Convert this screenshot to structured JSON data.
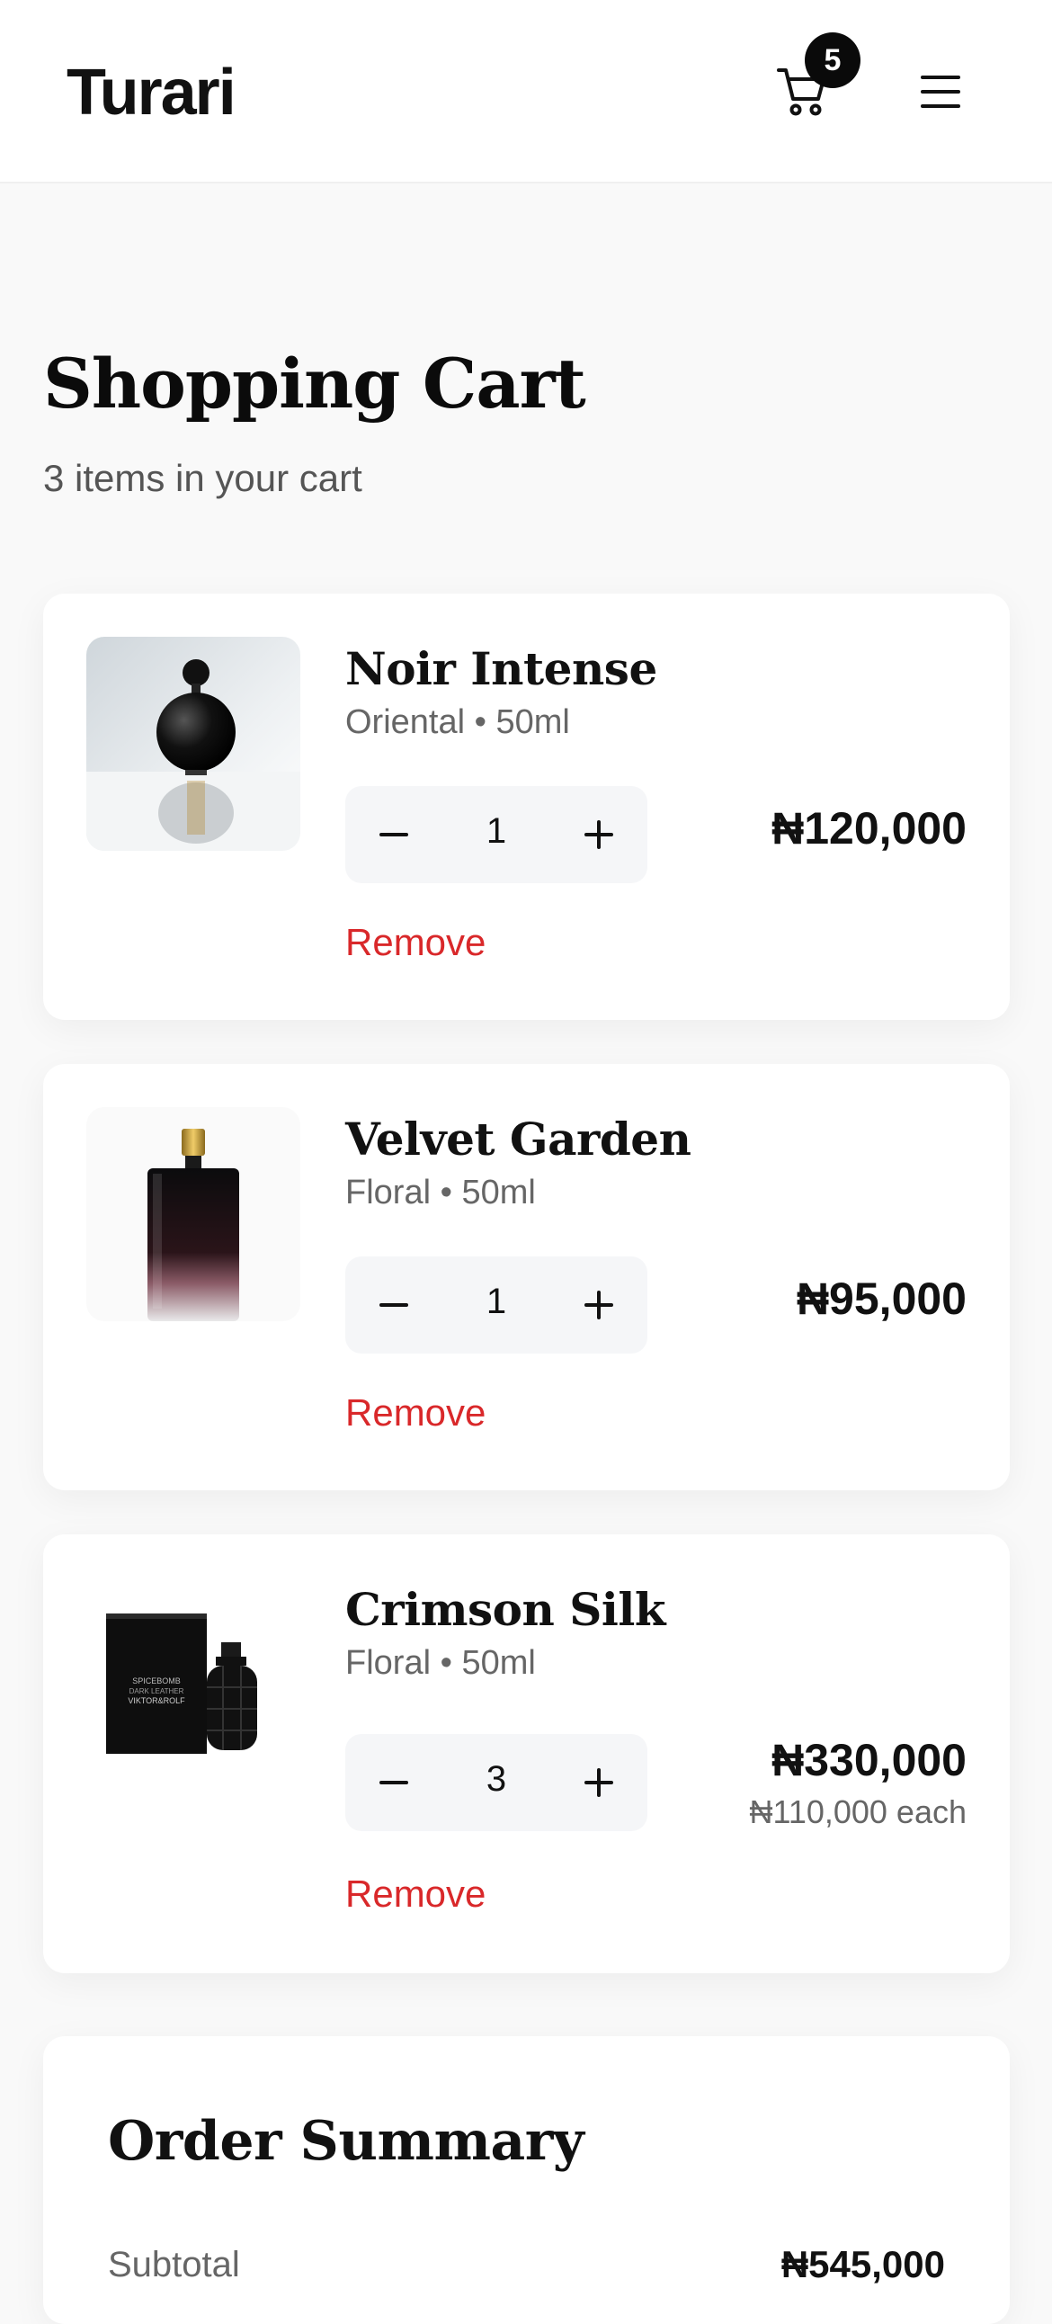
{
  "header": {
    "logo": "Turari",
    "cart_count": "5",
    "cart_icon": "cart-icon",
    "menu_icon": "menu-icon"
  },
  "page": {
    "title": "Shopping Cart",
    "subtitle": "3 items in your cart"
  },
  "cart": {
    "items": [
      {
        "name": "Noir Intense",
        "meta": "Oriental • 50ml",
        "quantity": "1",
        "price": "₦120,000",
        "unit_price": "",
        "remove_label": "Remove",
        "image": "black-round-perfume-bottle"
      },
      {
        "name": "Velvet Garden",
        "meta": "Floral • 50ml",
        "quantity": "1",
        "price": "₦95,000",
        "unit_price": "",
        "remove_label": "Remove",
        "image": "gradient-rectangular-perfume-bottle"
      },
      {
        "name": "Crimson Silk",
        "meta": "Floral • 50ml",
        "quantity": "3",
        "price": "₦330,000",
        "unit_price": "₦110,000 each",
        "remove_label": "Remove",
        "image": "black-grenade-perfume-with-box",
        "box_text": [
          "SPICEBOMB",
          "DARK LEATHER",
          "VIKTOR&ROLF"
        ]
      }
    ]
  },
  "summary": {
    "title": "Order Summary",
    "subtotal_label": "Subtotal",
    "subtotal_value": "₦545,000"
  },
  "colors": {
    "accent_remove": "#d9282a",
    "badge": "#0a0a0a",
    "background": "#f9f9f9"
  }
}
